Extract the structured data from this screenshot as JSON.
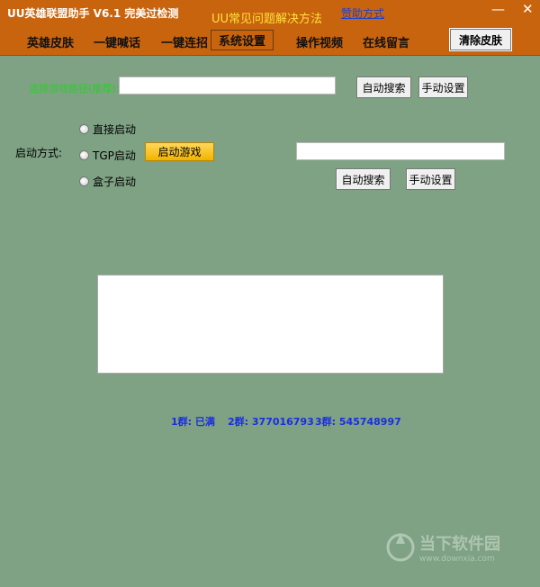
{
  "window": {
    "title": "UU英雄联盟助手 V6.1 完美过检测",
    "faq_link": "UU常见问题解决方法",
    "sponsor_link": "赞助方式",
    "minimize": "—",
    "close": "✕"
  },
  "menu": {
    "items": [
      "英雄皮肤",
      "一键喊话",
      "一键连招",
      "系统设置",
      "操作视频",
      "在线留言"
    ],
    "active": "系统设置",
    "clear_skin": "清除皮肤"
  },
  "settings": {
    "game_path_label": "选择游戏路径(推荐):",
    "auto_search": "自动搜索",
    "manual_set": "手动设置",
    "start_mode_label": "启动方式:",
    "radio_direct": "直接启动",
    "radio_tgp": "TGP启动",
    "radio_box": "盒子启动",
    "start_game": "启动游戏",
    "auto_search_2": "自动搜索",
    "manual_set_2": "手动设置"
  },
  "qq_groups": {
    "g1": "1群: 已满",
    "g2": "2群: 377016793",
    "g3": "3群: 545748997"
  },
  "watermark": {
    "text": "当下软件园",
    "url": "www.downxia.com"
  }
}
